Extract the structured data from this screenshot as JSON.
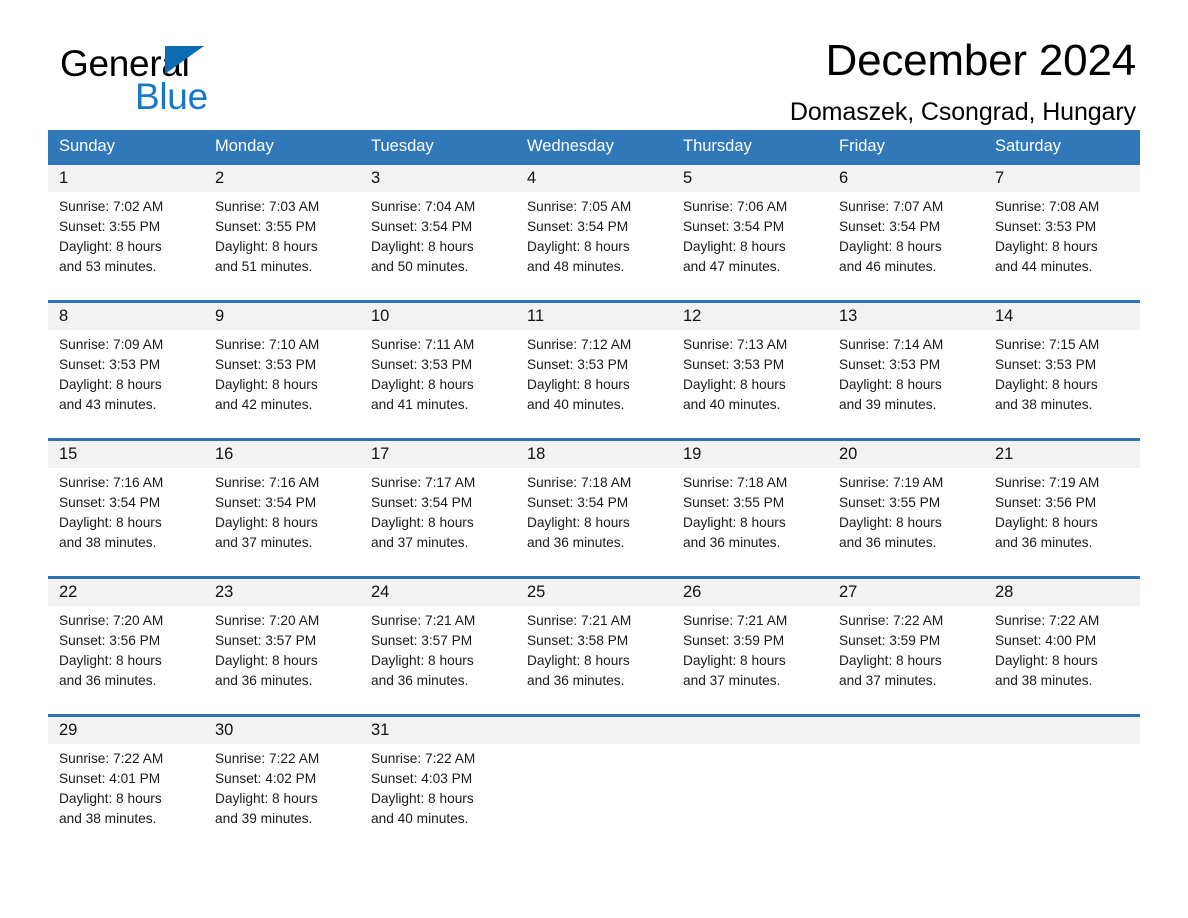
{
  "brand": {
    "name_part1": "General",
    "name_part2": "Blue",
    "triangle_icon": "triangle-icon",
    "accent_black": "#000000",
    "accent_blue": "#1878c8"
  },
  "header": {
    "title": "December 2024",
    "subtitle": "Domaszek, Csongrad, Hungary"
  },
  "colors": {
    "header_blue": "#3078b8",
    "week_divider_blue": "#2e74b5",
    "date_row_gray": "#f2f2f2",
    "text": "#000000"
  },
  "weekdays": [
    "Sunday",
    "Monday",
    "Tuesday",
    "Wednesday",
    "Thursday",
    "Friday",
    "Saturday"
  ],
  "weeks": [
    {
      "days": [
        {
          "date": "1",
          "sunrise": "Sunrise: 7:02 AM",
          "sunset": "Sunset: 3:55 PM",
          "daylight1": "Daylight: 8 hours",
          "daylight2": "and 53 minutes."
        },
        {
          "date": "2",
          "sunrise": "Sunrise: 7:03 AM",
          "sunset": "Sunset: 3:55 PM",
          "daylight1": "Daylight: 8 hours",
          "daylight2": "and 51 minutes."
        },
        {
          "date": "3",
          "sunrise": "Sunrise: 7:04 AM",
          "sunset": "Sunset: 3:54 PM",
          "daylight1": "Daylight: 8 hours",
          "daylight2": "and 50 minutes."
        },
        {
          "date": "4",
          "sunrise": "Sunrise: 7:05 AM",
          "sunset": "Sunset: 3:54 PM",
          "daylight1": "Daylight: 8 hours",
          "daylight2": "and 48 minutes."
        },
        {
          "date": "5",
          "sunrise": "Sunrise: 7:06 AM",
          "sunset": "Sunset: 3:54 PM",
          "daylight1": "Daylight: 8 hours",
          "daylight2": "and 47 minutes."
        },
        {
          "date": "6",
          "sunrise": "Sunrise: 7:07 AM",
          "sunset": "Sunset: 3:54 PM",
          "daylight1": "Daylight: 8 hours",
          "daylight2": "and 46 minutes."
        },
        {
          "date": "7",
          "sunrise": "Sunrise: 7:08 AM",
          "sunset": "Sunset: 3:53 PM",
          "daylight1": "Daylight: 8 hours",
          "daylight2": "and 44 minutes."
        }
      ]
    },
    {
      "days": [
        {
          "date": "8",
          "sunrise": "Sunrise: 7:09 AM",
          "sunset": "Sunset: 3:53 PM",
          "daylight1": "Daylight: 8 hours",
          "daylight2": "and 43 minutes."
        },
        {
          "date": "9",
          "sunrise": "Sunrise: 7:10 AM",
          "sunset": "Sunset: 3:53 PM",
          "daylight1": "Daylight: 8 hours",
          "daylight2": "and 42 minutes."
        },
        {
          "date": "10",
          "sunrise": "Sunrise: 7:11 AM",
          "sunset": "Sunset: 3:53 PM",
          "daylight1": "Daylight: 8 hours",
          "daylight2": "and 41 minutes."
        },
        {
          "date": "11",
          "sunrise": "Sunrise: 7:12 AM",
          "sunset": "Sunset: 3:53 PM",
          "daylight1": "Daylight: 8 hours",
          "daylight2": "and 40 minutes."
        },
        {
          "date": "12",
          "sunrise": "Sunrise: 7:13 AM",
          "sunset": "Sunset: 3:53 PM",
          "daylight1": "Daylight: 8 hours",
          "daylight2": "and 40 minutes."
        },
        {
          "date": "13",
          "sunrise": "Sunrise: 7:14 AM",
          "sunset": "Sunset: 3:53 PM",
          "daylight1": "Daylight: 8 hours",
          "daylight2": "and 39 minutes."
        },
        {
          "date": "14",
          "sunrise": "Sunrise: 7:15 AM",
          "sunset": "Sunset: 3:53 PM",
          "daylight1": "Daylight: 8 hours",
          "daylight2": "and 38 minutes."
        }
      ]
    },
    {
      "days": [
        {
          "date": "15",
          "sunrise": "Sunrise: 7:16 AM",
          "sunset": "Sunset: 3:54 PM",
          "daylight1": "Daylight: 8 hours",
          "daylight2": "and 38 minutes."
        },
        {
          "date": "16",
          "sunrise": "Sunrise: 7:16 AM",
          "sunset": "Sunset: 3:54 PM",
          "daylight1": "Daylight: 8 hours",
          "daylight2": "and 37 minutes."
        },
        {
          "date": "17",
          "sunrise": "Sunrise: 7:17 AM",
          "sunset": "Sunset: 3:54 PM",
          "daylight1": "Daylight: 8 hours",
          "daylight2": "and 37 minutes."
        },
        {
          "date": "18",
          "sunrise": "Sunrise: 7:18 AM",
          "sunset": "Sunset: 3:54 PM",
          "daylight1": "Daylight: 8 hours",
          "daylight2": "and 36 minutes."
        },
        {
          "date": "19",
          "sunrise": "Sunrise: 7:18 AM",
          "sunset": "Sunset: 3:55 PM",
          "daylight1": "Daylight: 8 hours",
          "daylight2": "and 36 minutes."
        },
        {
          "date": "20",
          "sunrise": "Sunrise: 7:19 AM",
          "sunset": "Sunset: 3:55 PM",
          "daylight1": "Daylight: 8 hours",
          "daylight2": "and 36 minutes."
        },
        {
          "date": "21",
          "sunrise": "Sunrise: 7:19 AM",
          "sunset": "Sunset: 3:56 PM",
          "daylight1": "Daylight: 8 hours",
          "daylight2": "and 36 minutes."
        }
      ]
    },
    {
      "days": [
        {
          "date": "22",
          "sunrise": "Sunrise: 7:20 AM",
          "sunset": "Sunset: 3:56 PM",
          "daylight1": "Daylight: 8 hours",
          "daylight2": "and 36 minutes."
        },
        {
          "date": "23",
          "sunrise": "Sunrise: 7:20 AM",
          "sunset": "Sunset: 3:57 PM",
          "daylight1": "Daylight: 8 hours",
          "daylight2": "and 36 minutes."
        },
        {
          "date": "24",
          "sunrise": "Sunrise: 7:21 AM",
          "sunset": "Sunset: 3:57 PM",
          "daylight1": "Daylight: 8 hours",
          "daylight2": "and 36 minutes."
        },
        {
          "date": "25",
          "sunrise": "Sunrise: 7:21 AM",
          "sunset": "Sunset: 3:58 PM",
          "daylight1": "Daylight: 8 hours",
          "daylight2": "and 36 minutes."
        },
        {
          "date": "26",
          "sunrise": "Sunrise: 7:21 AM",
          "sunset": "Sunset: 3:59 PM",
          "daylight1": "Daylight: 8 hours",
          "daylight2": "and 37 minutes."
        },
        {
          "date": "27",
          "sunrise": "Sunrise: 7:22 AM",
          "sunset": "Sunset: 3:59 PM",
          "daylight1": "Daylight: 8 hours",
          "daylight2": "and 37 minutes."
        },
        {
          "date": "28",
          "sunrise": "Sunrise: 7:22 AM",
          "sunset": "Sunset: 4:00 PM",
          "daylight1": "Daylight: 8 hours",
          "daylight2": "and 38 minutes."
        }
      ]
    },
    {
      "days": [
        {
          "date": "29",
          "sunrise": "Sunrise: 7:22 AM",
          "sunset": "Sunset: 4:01 PM",
          "daylight1": "Daylight: 8 hours",
          "daylight2": "and 38 minutes."
        },
        {
          "date": "30",
          "sunrise": "Sunrise: 7:22 AM",
          "sunset": "Sunset: 4:02 PM",
          "daylight1": "Daylight: 8 hours",
          "daylight2": "and 39 minutes."
        },
        {
          "date": "31",
          "sunrise": "Sunrise: 7:22 AM",
          "sunset": "Sunset: 4:03 PM",
          "daylight1": "Daylight: 8 hours",
          "daylight2": "and 40 minutes."
        },
        {
          "date": "",
          "sunrise": "",
          "sunset": "",
          "daylight1": "",
          "daylight2": ""
        },
        {
          "date": "",
          "sunrise": "",
          "sunset": "",
          "daylight1": "",
          "daylight2": ""
        },
        {
          "date": "",
          "sunrise": "",
          "sunset": "",
          "daylight1": "",
          "daylight2": ""
        },
        {
          "date": "",
          "sunrise": "",
          "sunset": "",
          "daylight1": "",
          "daylight2": ""
        }
      ]
    }
  ]
}
